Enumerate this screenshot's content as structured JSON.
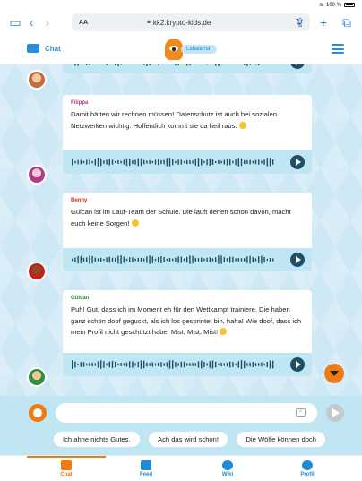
{
  "status_bar": {
    "battery": "100 %"
  },
  "browser": {
    "url": "kk2.krypto-kids.de",
    "aa_label": "AA"
  },
  "header": {
    "chat_label": "Chat",
    "user_pill": "Labalama!"
  },
  "messages": [
    {
      "sender": "",
      "text": ""
    },
    {
      "sender": "Filippa",
      "sender_color": "#b13c8a",
      "text": "Damit hätten wir rechnen müssen! Datenschutz ist auch bei sozialen Netzwerken wichtig. Hoffentlich kommt sie da heil raus."
    },
    {
      "sender": "Benny",
      "sender_color": "#d62a1a",
      "text": "Gülcan ist im Lauf-Team der Schule. Die läuft denen schon davon, macht euch keine Sorgen!"
    },
    {
      "sender": "Gülcan",
      "sender_color": "#2f8f3c",
      "text": "Puh! Gut, dass ich im Moment eh für den Wettkampf trainiere. Die haben ganz schön doof geguckt, als ich los gesprintet bin, haha! Wie doof, dass ich mein Profil nicht geschützt habe. Mist, Mist, Mist!"
    }
  ],
  "input": {
    "value": "",
    "placeholder": ""
  },
  "suggestions": [
    "Ich ahne nichts Gutes.",
    "Ach das wird schon!",
    "Die Wölfe können doch"
  ],
  "nav": [
    {
      "label": "Chat",
      "icon": "chat-icon",
      "active": true
    },
    {
      "label": "Feed",
      "icon": "feed-icon",
      "active": false
    },
    {
      "label": "Wiki",
      "icon": "wiki-icon",
      "active": false
    },
    {
      "label": "Profil",
      "icon": "profile-icon",
      "active": false
    }
  ],
  "colors": {
    "accent": "#2a8fd8",
    "orange": "#f07b12",
    "audio_bg": "#bfe6f2"
  }
}
